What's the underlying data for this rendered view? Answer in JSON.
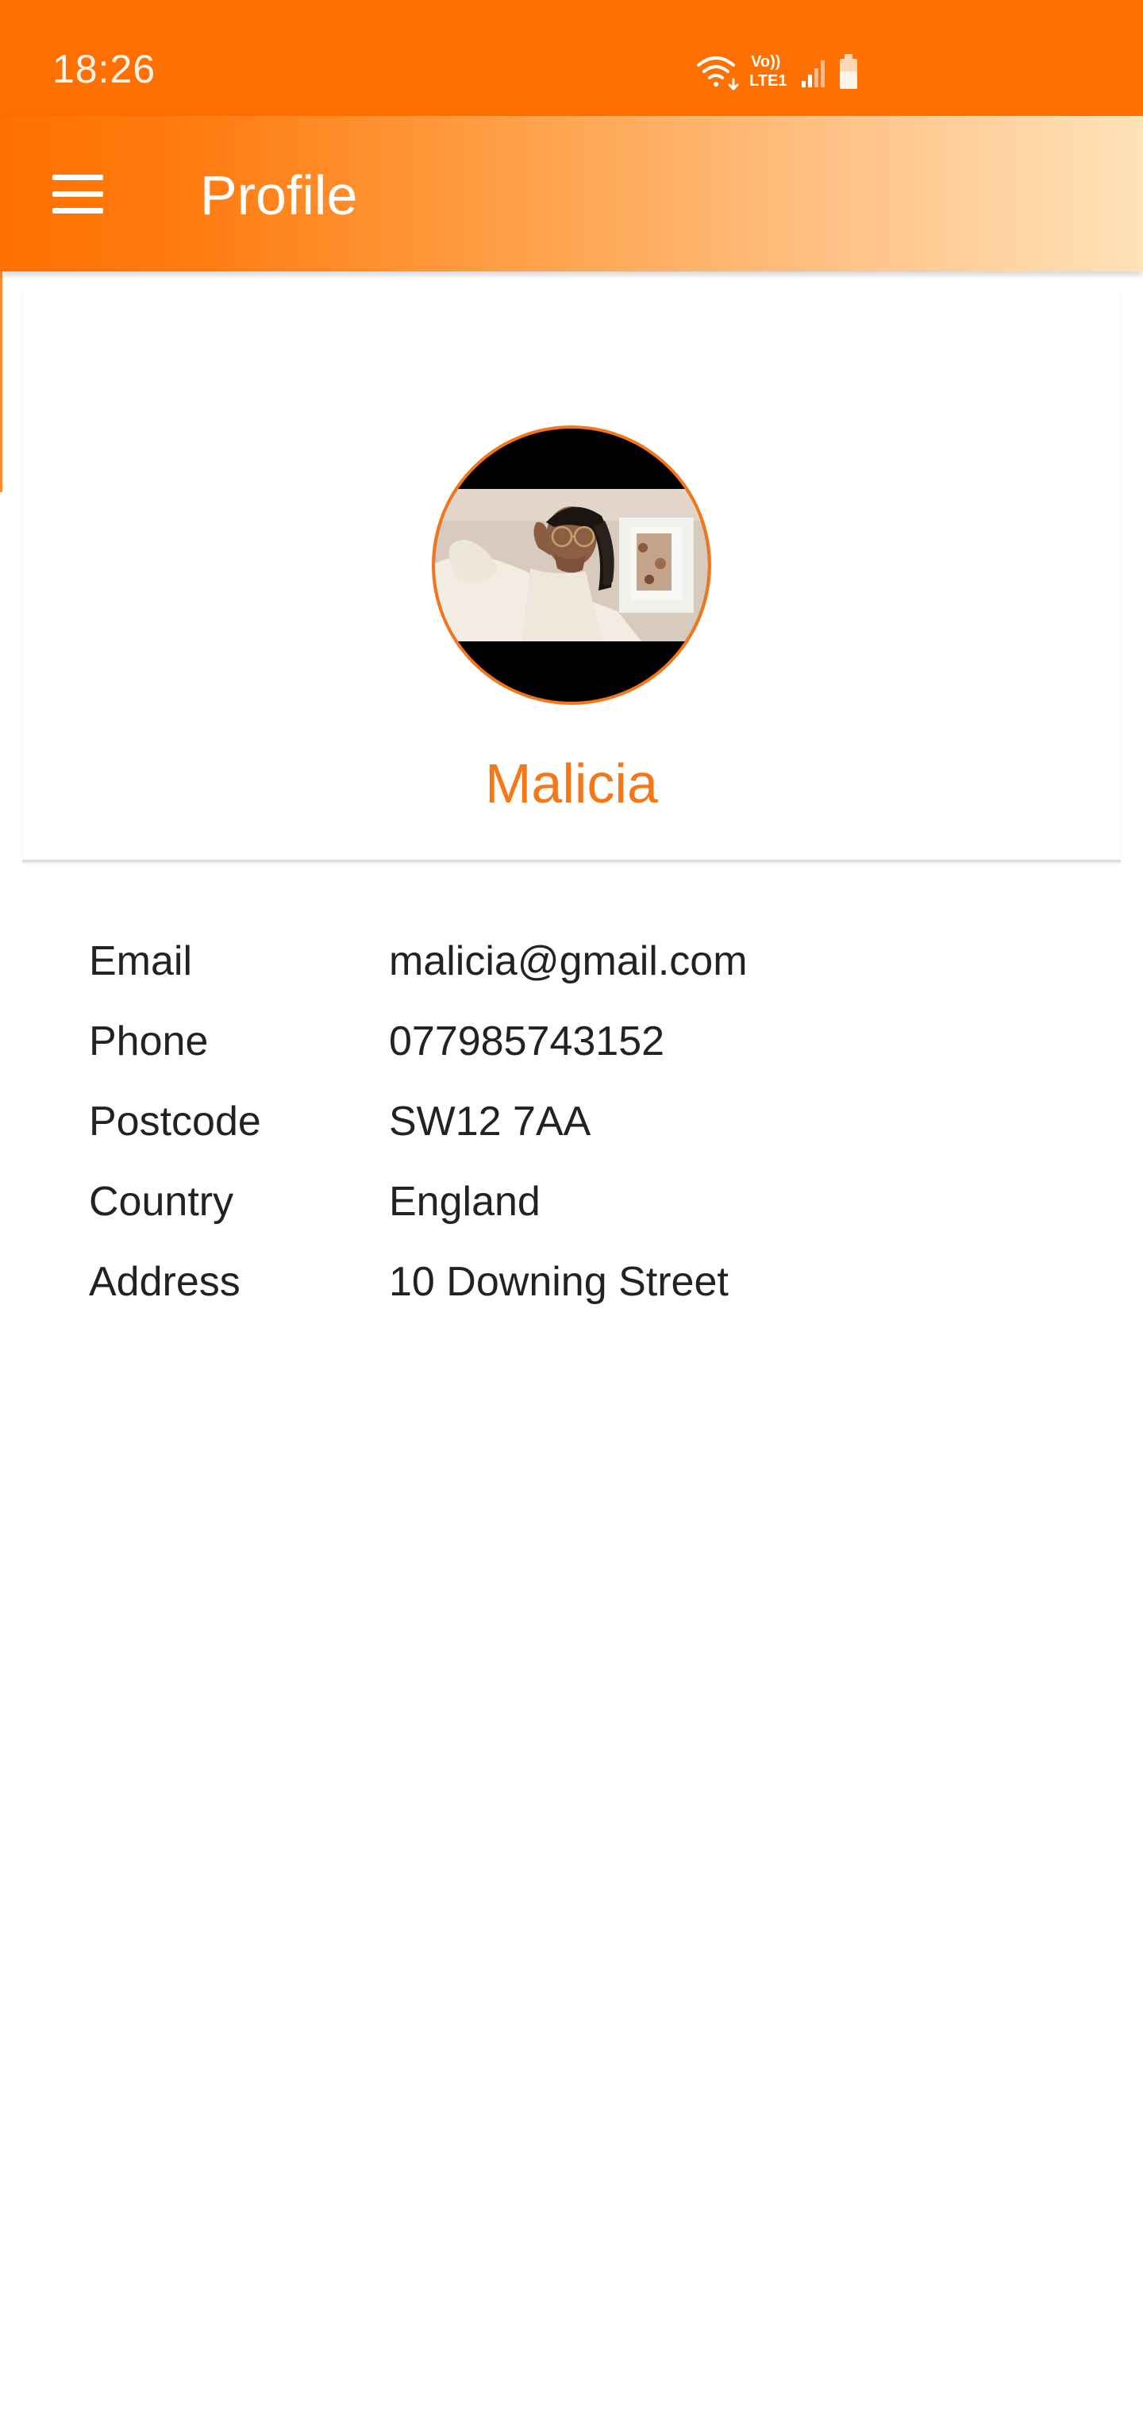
{
  "status_bar": {
    "time": "18:26",
    "volte_label": "Vo))",
    "network_label": "LTE1",
    "icons": [
      "wifi-icon",
      "signal-icon",
      "battery-icon"
    ]
  },
  "app_bar": {
    "title": "Profile",
    "menu_icon": "hamburger-menu-icon"
  },
  "profile": {
    "name": "Malicia"
  },
  "details": [
    {
      "label": "Email",
      "value": "malicia@gmail.com"
    },
    {
      "label": "Phone",
      "value": "077985743152"
    },
    {
      "label": "Postcode",
      "value": "SW12 7AA"
    },
    {
      "label": "Country",
      "value": "England"
    },
    {
      "label": "Address",
      "value": "10 Downing Street"
    }
  ],
  "colors": {
    "primary": "#ff7000",
    "accent_text": "#f47718",
    "gradient_end": "#ffe2b8",
    "text": "#222222"
  }
}
